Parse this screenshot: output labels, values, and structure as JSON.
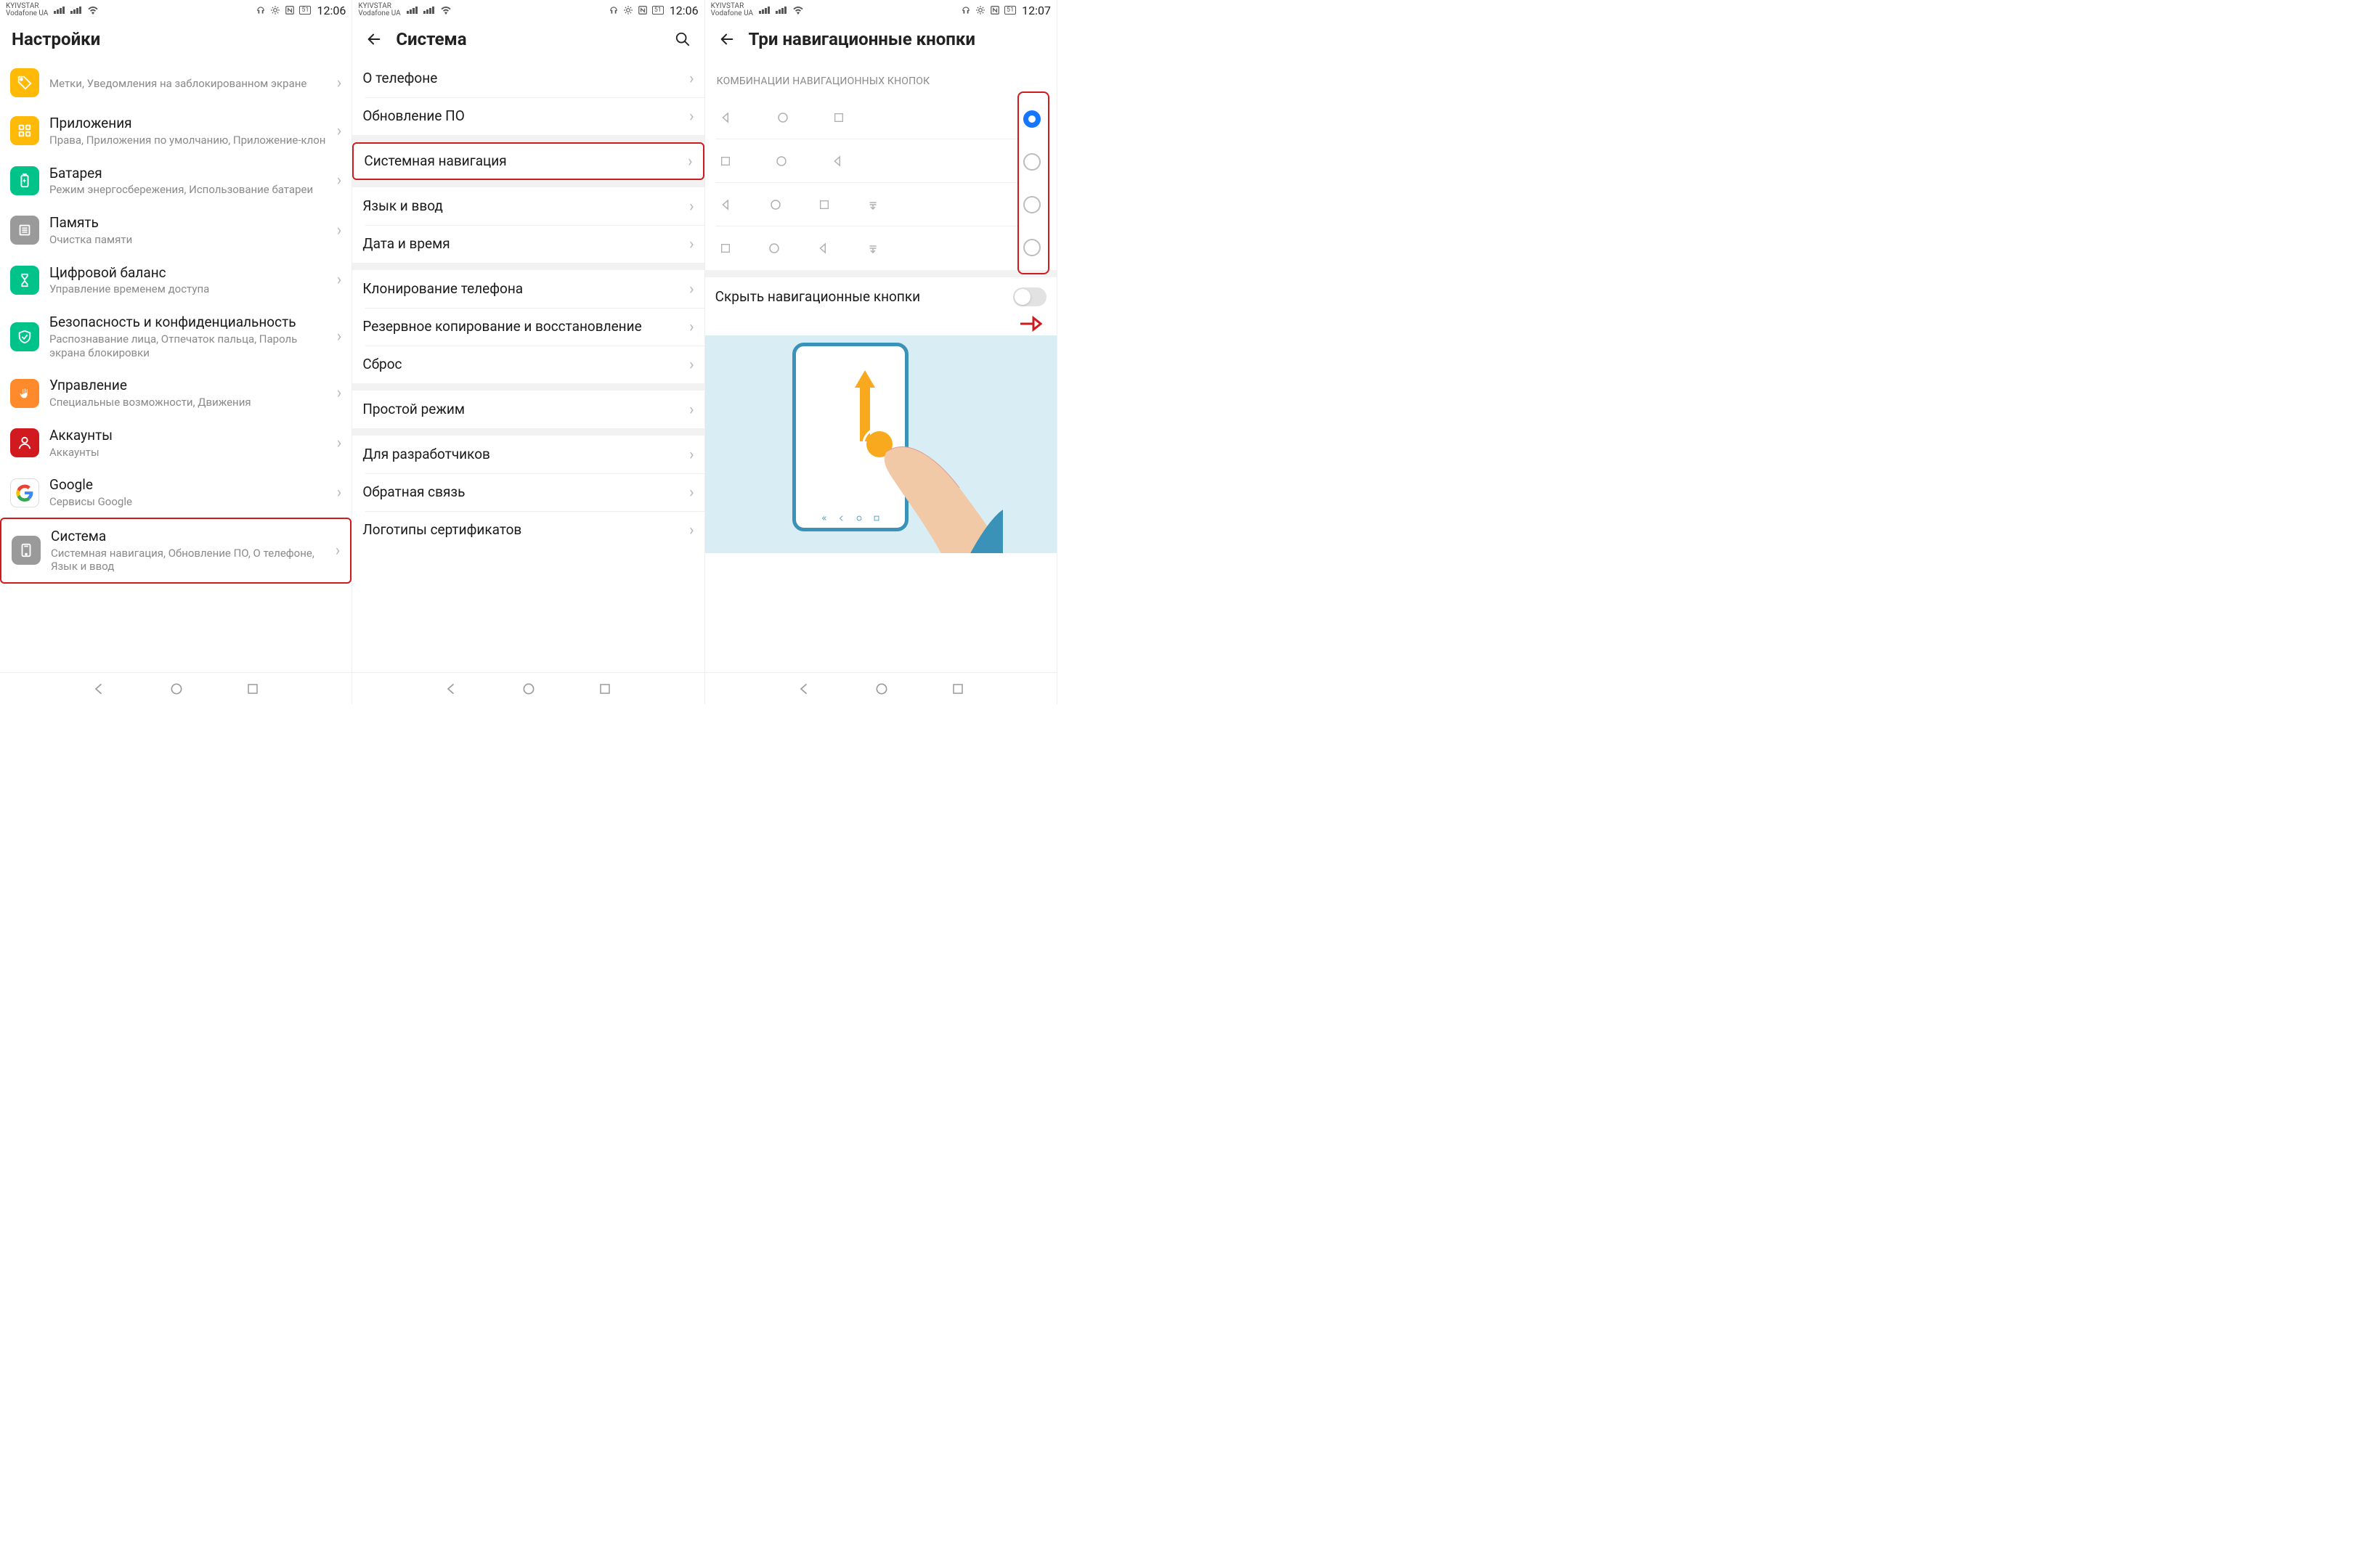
{
  "status": {
    "carrier1": "KYIVSTAR",
    "carrier2": "Vodafone UA",
    "battery": "51",
    "time_a": "12:06",
    "time_b": "12:07"
  },
  "s1": {
    "title": "Настройки",
    "items": [
      {
        "title": "",
        "subtitle": "Метки, Уведомления на заблокированном экране",
        "icon_bg": "#ffba08",
        "icon_name": "tag-icon"
      },
      {
        "title": "Приложения",
        "subtitle": "Права, Приложения по умолчанию, Приложение-клон",
        "icon_bg": "#ffba08",
        "icon_name": "apps-icon"
      },
      {
        "title": "Батарея",
        "subtitle": "Режим энергосбережения, Использование батареи",
        "icon_bg": "#00c389",
        "icon_name": "battery-icon"
      },
      {
        "title": "Память",
        "subtitle": "Очистка памяти",
        "icon_bg": "#9a9a9a",
        "icon_name": "memory-icon"
      },
      {
        "title": "Цифровой баланс",
        "subtitle": "Управление временем доступа",
        "icon_bg": "#00c389",
        "icon_name": "hourglass-icon"
      },
      {
        "title": "Безопасность и конфиденциальность",
        "subtitle": "Распознавание лица, Отпечаток пальца, Пароль экрана блокировки",
        "icon_bg": "#00c389",
        "icon_name": "shield-icon"
      },
      {
        "title": "Управление",
        "subtitle": "Специальные возможности, Движения",
        "icon_bg": "#ff8a2b",
        "icon_name": "hand-icon"
      },
      {
        "title": "Аккаунты",
        "subtitle": "Аккаунты",
        "icon_bg": "#d11a1f",
        "icon_name": "account-icon"
      },
      {
        "title": "Google",
        "subtitle": "Сервисы Google",
        "icon_bg": "#ffffff",
        "icon_name": "google-icon"
      },
      {
        "title": "Система",
        "subtitle": "Системная навигация, Обновление ПО, О телефоне, Язык и ввод",
        "icon_bg": "#9a9a9a",
        "icon_name": "system-icon"
      }
    ]
  },
  "s2": {
    "title": "Система",
    "groups": [
      [
        "О телефоне",
        "Обновление ПО"
      ],
      [
        "Системная навигация"
      ],
      [
        "Язык и ввод",
        "Дата и время"
      ],
      [
        "Клонирование телефона",
        "Резервное копирование и восстановление",
        "Сброс"
      ],
      [
        "Простой режим"
      ],
      [
        "Для разработчиков",
        "Обратная связь",
        "Логотипы сертификатов"
      ]
    ],
    "highlighted": "Системная навигация"
  },
  "s3": {
    "title": "Три навигационные кнопки",
    "section_header": "КОМБИНАЦИИ НАВИГАЦИОННЫХ КНОПОК",
    "combos": [
      {
        "icons": [
          "back",
          "home",
          "recent"
        ],
        "selected": true
      },
      {
        "icons": [
          "recent",
          "home",
          "back"
        ],
        "selected": false
      },
      {
        "icons": [
          "back",
          "home",
          "recent",
          "notif"
        ],
        "selected": false
      },
      {
        "icons": [
          "recent",
          "home",
          "back",
          "notif"
        ],
        "selected": false
      }
    ],
    "hide_label": "Скрыть навигационные кнопки",
    "hide_value": false
  }
}
